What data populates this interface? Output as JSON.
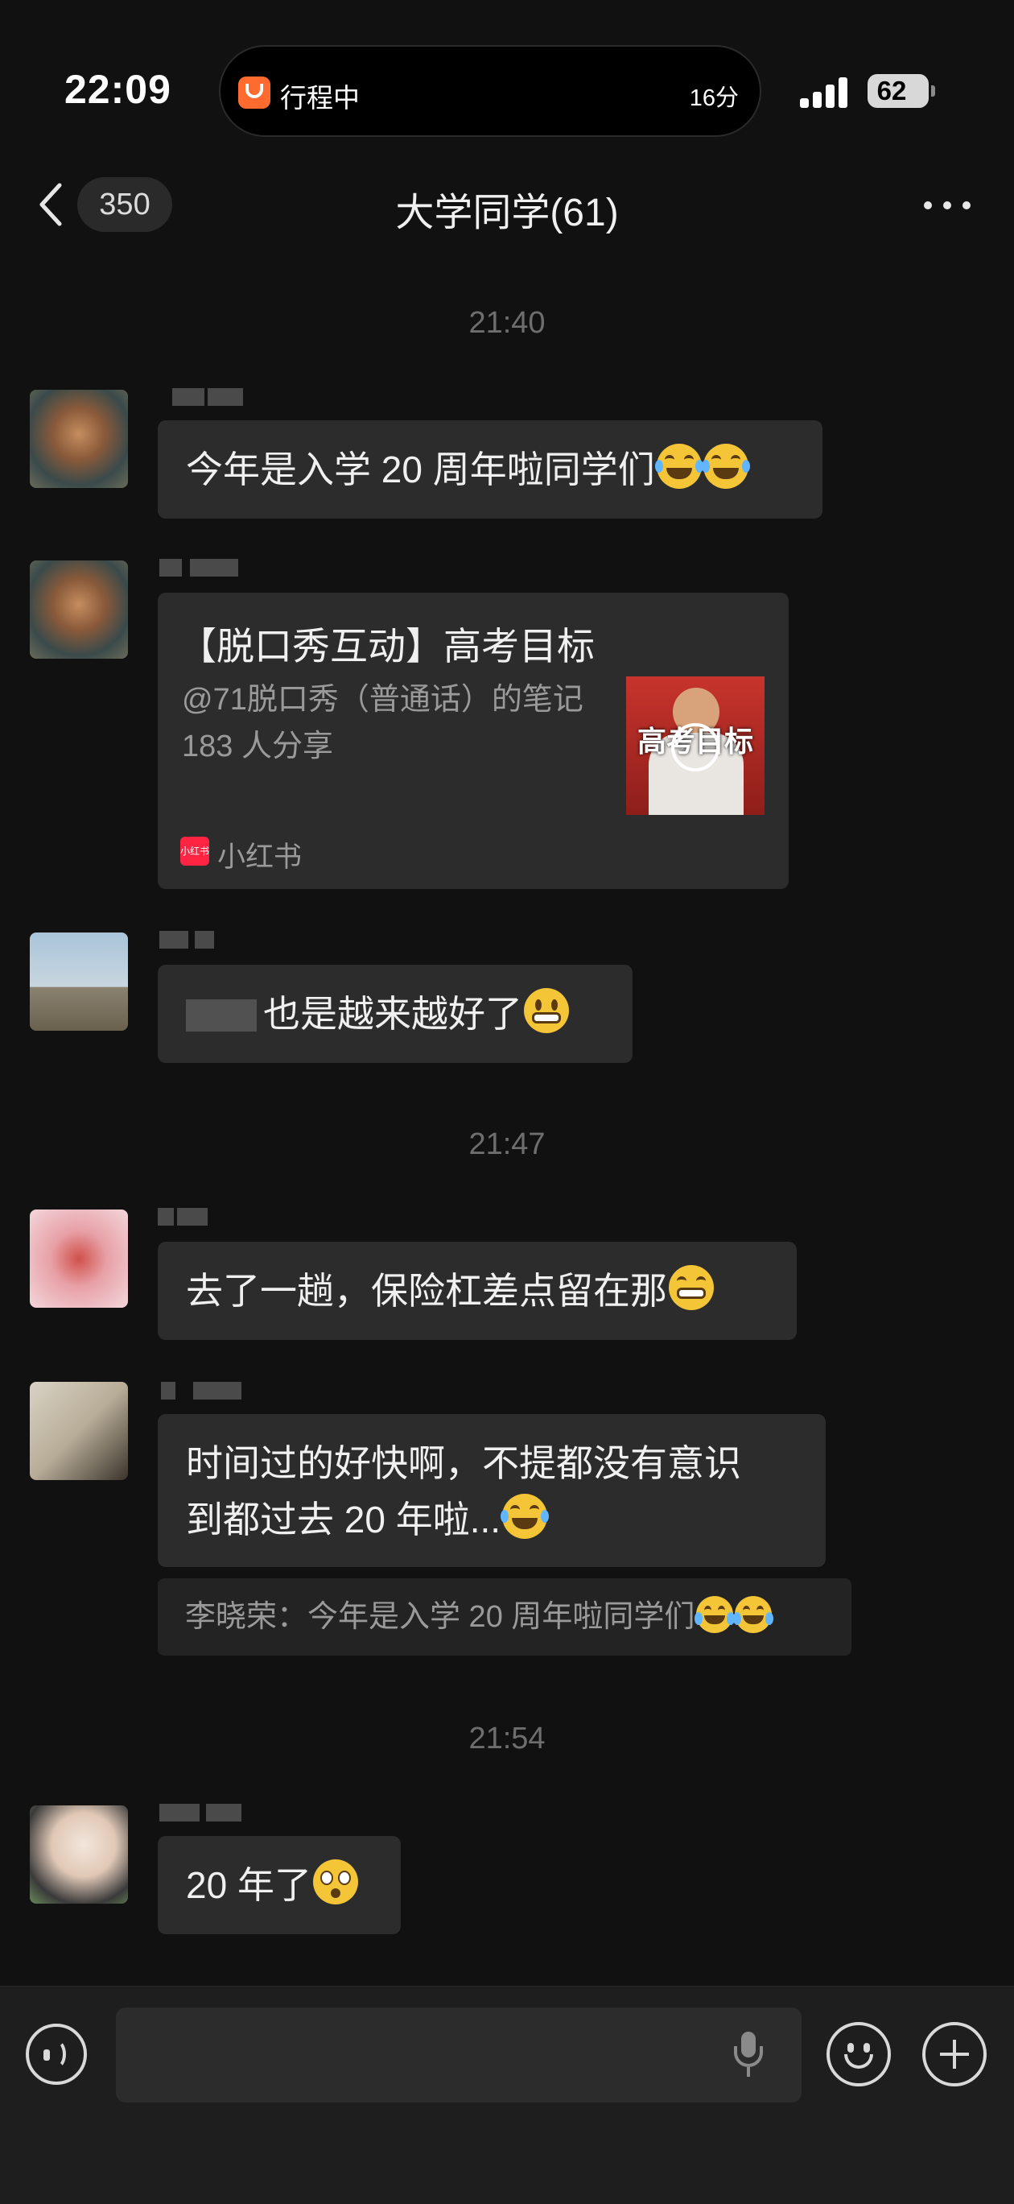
{
  "status_bar": {
    "time": "22:09",
    "activity_label": "行程中",
    "activity_eta": "16分",
    "battery": "62"
  },
  "nav": {
    "unread_badge": "350",
    "title": "大学同学(61)"
  },
  "timestamps": [
    "21:40",
    "21:47",
    "21:54"
  ],
  "messages": [
    {
      "text": "今年是入学 20 周年啦同学们",
      "emoji": [
        "joy-emoji",
        "joy-emoji"
      ]
    },
    {
      "type": "card"
    },
    {
      "text": "也是越来越好了",
      "emoji": [
        "grin-emoji"
      ]
    },
    {
      "text": "去了一趟，保险杠差点留在那",
      "emoji": [
        "hand-over-mouth-emoji"
      ]
    },
    {
      "line1": "时间过的好快啊，不提都没有意识",
      "line2": "到都过去 20 年啦...",
      "emoji": [
        "crying-laughing-emoji"
      ]
    },
    {
      "text": "20 年了",
      "emoji": [
        "flushed-emoji"
      ]
    }
  ],
  "card": {
    "title": "【脱口秀互动】高考目标",
    "author_line": "@71脱口秀（普通话）的笔记",
    "shares": "183 人分享",
    "thumb_text": "高考目标",
    "source_icon_text": "小红书",
    "source": "小红书"
  },
  "quote": {
    "text": "李晓荣：今年是入学 20 周年啦同学们"
  },
  "input": {
    "value": ""
  },
  "colors": {
    "background": "#111111",
    "bubble": "#2c2c2c",
    "xiaohongshu_red": "#ff2442",
    "didi_orange": "#ff6a2e"
  }
}
